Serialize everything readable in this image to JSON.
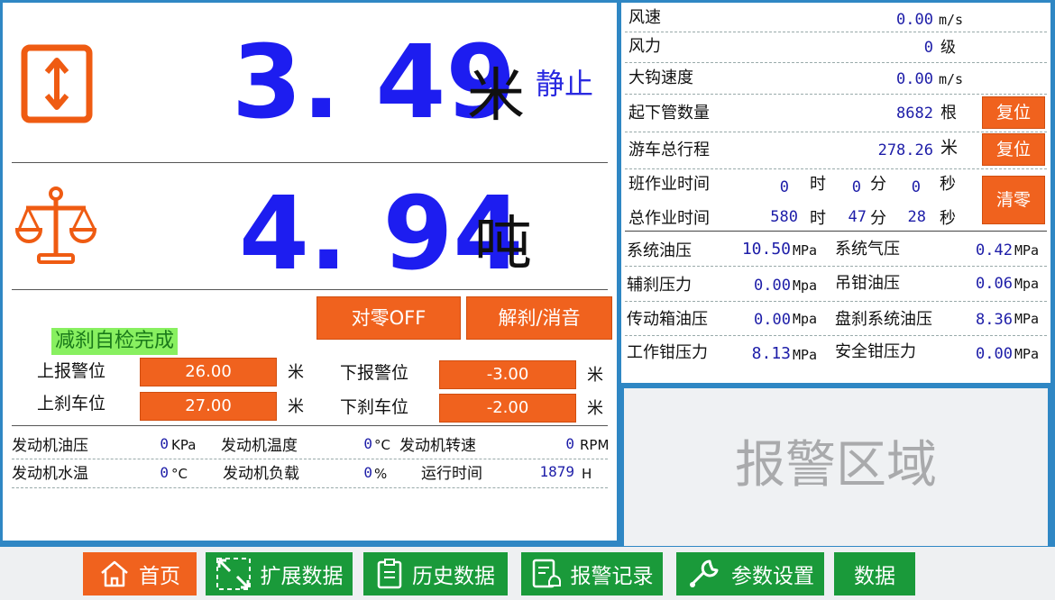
{
  "height": {
    "value": "3. 49",
    "unit": "米",
    "status": "静止"
  },
  "weight": {
    "value": "4. 94",
    "unit": "吨"
  },
  "buttons": {
    "zero": "对零OFF",
    "unbrake": "解刹/消音",
    "reset1": "复位",
    "reset2": "复位",
    "clear": "清零"
  },
  "check_status": "减刹自检完成",
  "limits": {
    "upper_alarm": {
      "label": "上报警位",
      "value": "26.00",
      "unit": "米"
    },
    "lower_alarm": {
      "label": "下报警位",
      "value": "-3.00",
      "unit": "米"
    },
    "upper_brake": {
      "label": "上刹车位",
      "value": "27.00",
      "unit": "米"
    },
    "lower_brake": {
      "label": "下刹车位",
      "value": "-2.00",
      "unit": "米"
    }
  },
  "engine": {
    "oil_pressure": {
      "label": "发动机油压",
      "value": "0",
      "unit": "KPa"
    },
    "temperature": {
      "label": "发动机温度",
      "value": "0",
      "unit": "°C"
    },
    "rpm": {
      "label": "发动机转速",
      "value": "0",
      "unit": "RPM"
    },
    "water_temp": {
      "label": "发动机水温",
      "value": "0",
      "unit": "°C"
    },
    "load": {
      "label": "发动机负载",
      "value": "0",
      "unit": "%"
    },
    "runtime": {
      "label": "运行时间",
      "value": "1879",
      "unit": "H"
    }
  },
  "right": {
    "wind_speed": {
      "label": "风速",
      "value": "0.00",
      "unit": "m/s"
    },
    "wind_force": {
      "label": "风力",
      "value": "0",
      "unit": "级"
    },
    "hook_speed": {
      "label": "大钩速度",
      "value": "0.00",
      "unit": "m/s"
    },
    "pipe_count": {
      "label": "起下管数量",
      "value": "8682",
      "unit": "根"
    },
    "travel_total": {
      "label": "游车总行程",
      "value": "278.26",
      "unit": "米"
    },
    "shift_time": {
      "label": "班作业时间",
      "h": "0",
      "m": "0",
      "s": "0"
    },
    "total_time": {
      "label": "总作业时间",
      "h": "580",
      "m": "47",
      "s": "28"
    },
    "time_units": {
      "h": "时",
      "m": "分",
      "s": "秒"
    },
    "pressures": [
      {
        "label": "系统油压",
        "value": "10.50",
        "unit": "MPa"
      },
      {
        "label": "系统气压",
        "value": "0.42",
        "unit": "MPa"
      },
      {
        "label": "辅刹压力",
        "value": "0.00",
        "unit": "Mpa"
      },
      {
        "label": "吊钳油压",
        "value": "0.06",
        "unit": "Mpa"
      },
      {
        "label": "传动箱油压",
        "value": "0.00",
        "unit": "Mpa"
      },
      {
        "label": "盘刹系统油压",
        "value": "8.36",
        "unit": "MPa"
      },
      {
        "label": "工作钳压力",
        "value": "8.13",
        "unit": "MPa"
      },
      {
        "label": "安全钳压力",
        "value": "0.00",
        "unit": "MPa"
      }
    ]
  },
  "alarm_area": "报警区域",
  "nav": [
    "首页",
    "扩展数据",
    "历史数据",
    "报警记录",
    "参数设置",
    "数据"
  ],
  "colors": {
    "blue_value": "#1d1df0",
    "orange": "#f0621e",
    "green": "#1a9a3a",
    "check_bg": "#88f060"
  }
}
